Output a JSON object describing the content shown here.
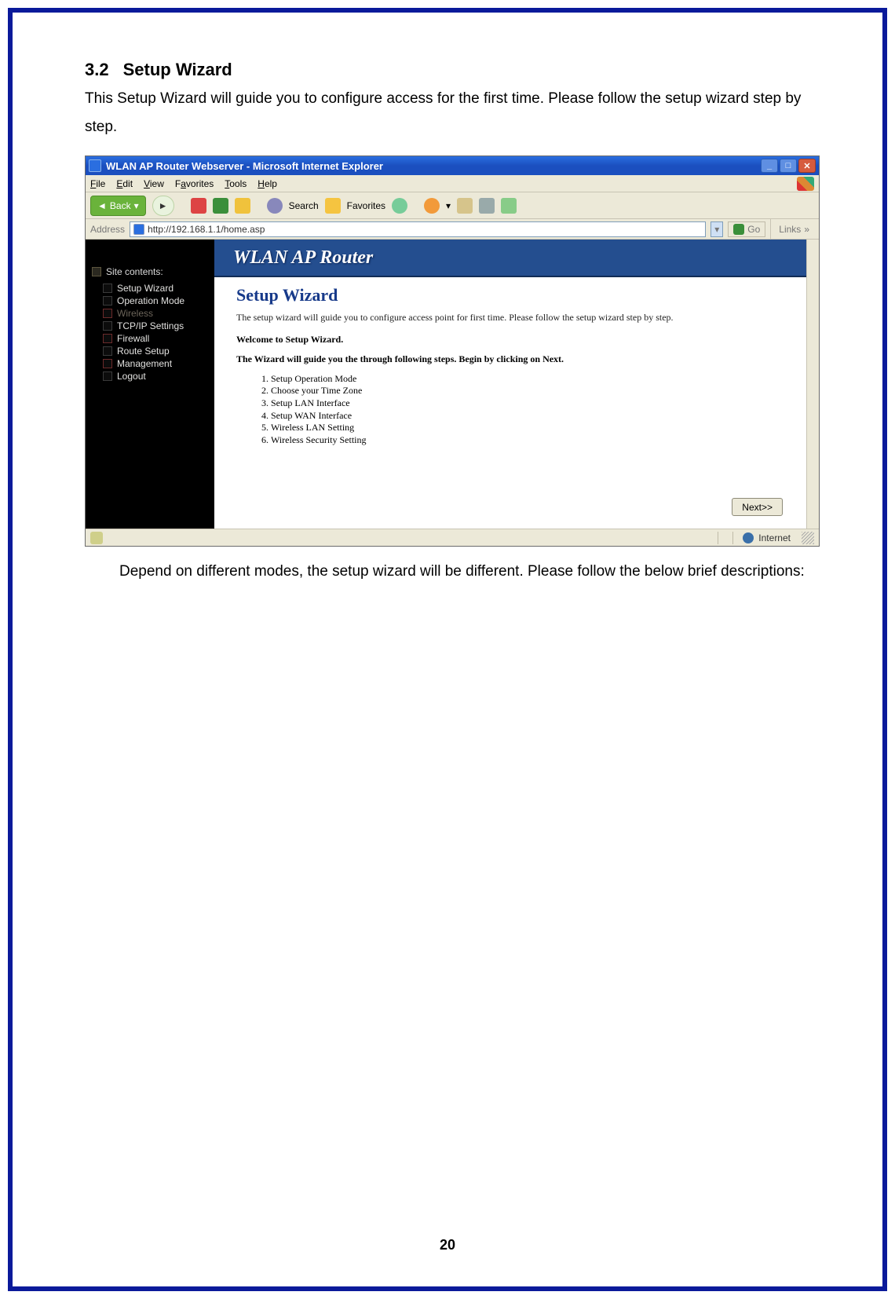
{
  "doc": {
    "section_number": "3.2",
    "section_title": "Setup Wizard",
    "intro": "This Setup Wizard will guide you to configure access for the first time. Please follow the setup wizard step by step.",
    "outro": "Depend on different modes, the setup wizard will be different. Please follow the below brief descriptions:",
    "page_number": "20"
  },
  "browser": {
    "title": "WLAN AP Router Webserver - Microsoft Internet Explorer",
    "menu": {
      "file": "File",
      "edit": "Edit",
      "view": "View",
      "favorites": "Favorites",
      "tools": "Tools",
      "help": "Help"
    },
    "toolbar": {
      "back": "Back",
      "search": "Search",
      "favorites": "Favorites"
    },
    "address": {
      "label": "Address",
      "url": "http://192.168.1.1/home.asp",
      "go": "Go",
      "links": "Links"
    },
    "status": {
      "zone": "Internet"
    }
  },
  "router": {
    "banner": "WLAN AP Router",
    "sidebar": {
      "title": "Site contents:",
      "items": [
        {
          "label": "Setup Wizard",
          "dim": false
        },
        {
          "label": "Operation Mode",
          "dim": false
        },
        {
          "label": "Wireless",
          "dim": true
        },
        {
          "label": "TCP/IP Settings",
          "dim": false
        },
        {
          "label": "Firewall",
          "dim": false
        },
        {
          "label": "Route Setup",
          "dim": false
        },
        {
          "label": "Management",
          "dim": false
        },
        {
          "label": "Logout",
          "dim": false
        }
      ]
    },
    "wizard": {
      "heading": "Setup Wizard",
      "desc": "The setup wizard will guide you to configure access point for first time. Please follow the setup wizard step by step.",
      "welcome": "Welcome to Setup Wizard.",
      "instruction": "The Wizard will guide you the through following steps. Begin by clicking on Next.",
      "steps": [
        "Setup Operation Mode",
        "Choose your Time Zone",
        "Setup LAN Interface",
        "Setup WAN Interface",
        "Wireless LAN Setting",
        "Wireless Security Setting"
      ],
      "next_label": "Next>>"
    }
  }
}
